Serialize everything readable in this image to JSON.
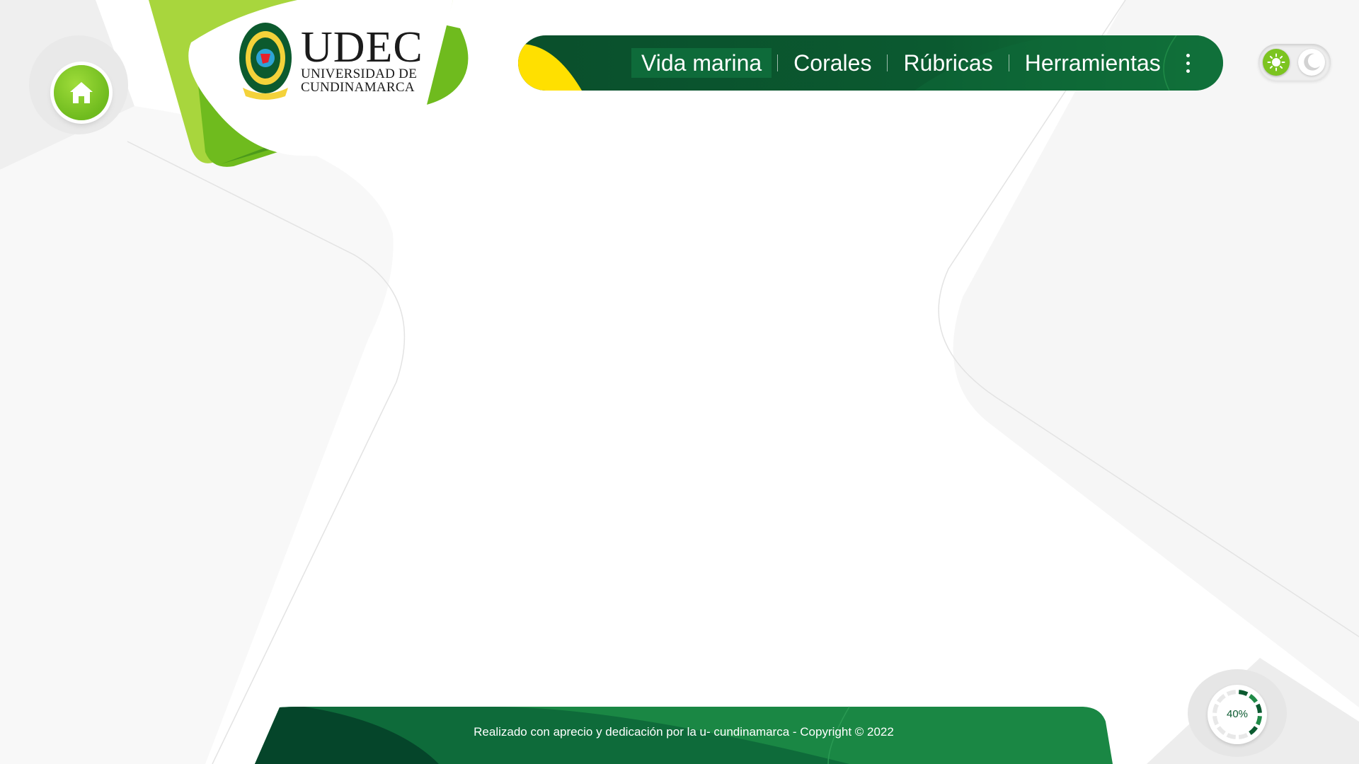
{
  "brand": {
    "name_big": "UDEC",
    "name_line1": "UNIVERSIDAD DE",
    "name_line2": "CUNDINAMARCA",
    "seal_icon": "university-seal-icon"
  },
  "home": {
    "icon": "home-icon"
  },
  "nav": {
    "items": [
      {
        "label": "Vida marina",
        "active": true
      },
      {
        "label": "Corales",
        "active": false
      },
      {
        "label": "Rúbricas",
        "active": false
      },
      {
        "label": "Herramientas",
        "active": false
      }
    ],
    "more_icon": "more-vertical-icon"
  },
  "theme_toggle": {
    "light_icon": "sun-icon",
    "dark_icon": "moon-icon",
    "selected": "light"
  },
  "progress": {
    "label": "40%",
    "value": 0.4
  },
  "footer": {
    "text": "Realizado con aprecio y dedicación por la u- cundinamarca - Copyright © 2022"
  },
  "colors": {
    "dark_green": "#0a4f2c",
    "green": "#137a3d",
    "lime": "#8cc63f",
    "yellow": "#ffe000"
  }
}
